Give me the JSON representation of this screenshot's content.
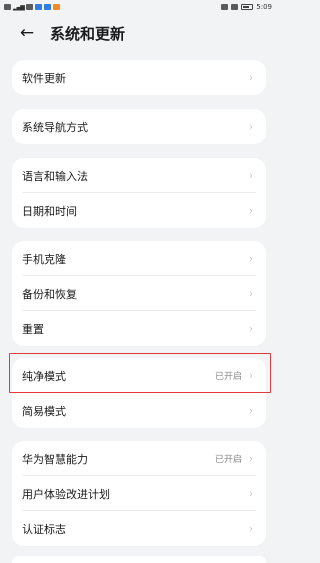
{
  "status_bar": {
    "time": "5:09"
  },
  "header": {
    "title": "系统和更新",
    "back_glyph": "←"
  },
  "groups": [
    {
      "items": [
        {
          "label": "软件更新",
          "value": ""
        }
      ]
    },
    {
      "items": [
        {
          "label": "系统导航方式",
          "value": ""
        }
      ]
    },
    {
      "items": [
        {
          "label": "语言和输入法",
          "value": ""
        },
        {
          "label": "日期和时间",
          "value": ""
        }
      ]
    },
    {
      "items": [
        {
          "label": "手机克隆",
          "value": ""
        },
        {
          "label": "备份和恢复",
          "value": ""
        },
        {
          "label": "重置",
          "value": ""
        }
      ]
    },
    {
      "items": [
        {
          "label": "纯净模式",
          "value": "已开启"
        },
        {
          "label": "简易模式",
          "value": ""
        }
      ]
    },
    {
      "items": [
        {
          "label": "华为智慧能力",
          "value": "已开启"
        },
        {
          "label": "用户体验改进计划",
          "value": ""
        },
        {
          "label": "认证标志",
          "value": ""
        }
      ]
    }
  ],
  "chevron": "›",
  "colors": {
    "background": "#f1f3f5",
    "card": "#ffffff",
    "highlight": "#e0393e"
  }
}
